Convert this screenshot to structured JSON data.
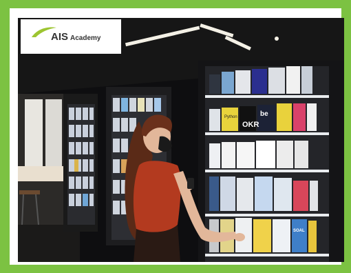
{
  "logo": {
    "brand": "AIS",
    "subtitle": "Academy",
    "icon": "ais-swoosh-icon"
  },
  "colors": {
    "frame": "#7cc242",
    "logo_accent": "#9dc531",
    "shirt": "#b33a1f",
    "hair": "#5a2a17"
  },
  "scene": {
    "book_labels": [
      "Python",
      "OKR",
      "be",
      "SOAL"
    ]
  }
}
